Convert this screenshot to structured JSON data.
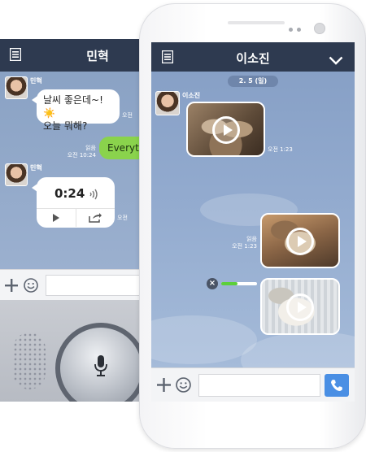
{
  "back_chat": {
    "title": "민혁",
    "sender_name": "민혁",
    "message_1": "날씨 좋은데~! ☀️",
    "message_1_line2": "오늘 뭐해?",
    "message_1_time": "오전",
    "my_message": "Everyth",
    "my_message_read": "읽음",
    "my_message_time": "오전 10:24",
    "sender_name_2": "민혁",
    "voice_duration": "0:24",
    "voice_time": "오전"
  },
  "front_chat": {
    "title": "이소진",
    "date_label": "2. 5 (일)",
    "sender_name": "이소진",
    "video_1_time": "오전 1:23",
    "video_2_read": "읽음",
    "video_2_time": "오전 1:23",
    "upload_progress": 0.45
  },
  "icons": {
    "menu": "menu-icon",
    "chevron": "chevron-down-icon",
    "add": "plus-icon",
    "emoji": "smiley-icon",
    "mic": "mic-icon",
    "call": "phone-icon",
    "play": "play-icon",
    "share": "share-icon",
    "speaker": "sound-wave-icon",
    "cancel": "close-icon"
  },
  "colors": {
    "header": "#2e3a50",
    "chat_bg": "#8aa2c6",
    "my_bubble": "#8ad34c",
    "call_button": "#4a8fe4",
    "progress": "#5ccf3a"
  }
}
